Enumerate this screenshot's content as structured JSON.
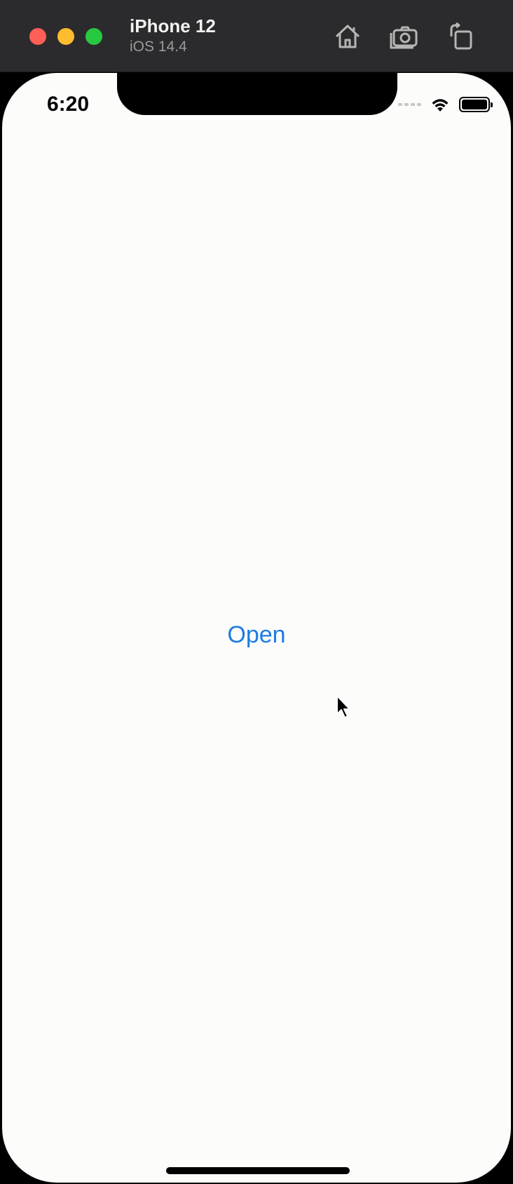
{
  "simulator": {
    "device_name": "iPhone 12",
    "os_version": "iOS 14.4",
    "window_controls": [
      "close",
      "minimize",
      "zoom"
    ],
    "toolbar_icons": [
      "home-icon",
      "screenshot-icon",
      "rotate-icon"
    ]
  },
  "status_bar": {
    "time": "6:20"
  },
  "main": {
    "open_button_label": "Open"
  },
  "colors": {
    "accent": "#1b7ce4",
    "background": "#fcfcfb",
    "titlebar": "#2b2b2d"
  }
}
